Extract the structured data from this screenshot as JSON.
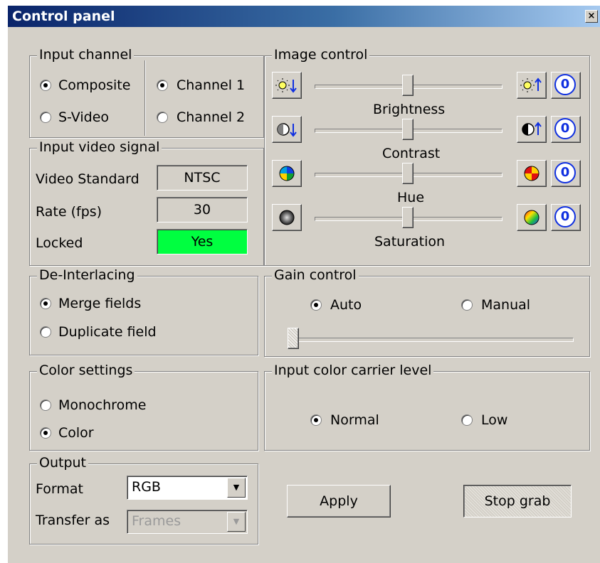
{
  "window": {
    "title": "Control panel",
    "close_glyph": "×"
  },
  "input_channel": {
    "legend": "Input channel",
    "composite": "Composite",
    "svideo": "S-Video",
    "channel1": "Channel 1",
    "channel2": "Channel 2",
    "selected_source": "Composite",
    "selected_channel": "Channel 1"
  },
  "input_video_signal": {
    "legend": "Input video signal",
    "standard_label": "Video Standard",
    "standard_value": "NTSC",
    "rate_label": "Rate (fps)",
    "rate_value": "30",
    "locked_label": "Locked",
    "locked_value": "Yes",
    "locked_color": "#00ff40"
  },
  "image_control": {
    "legend": "Image control",
    "sliders": [
      {
        "label": "Brightness",
        "level": 0.5,
        "dec_icon": "brightness-down-icon",
        "inc_icon": "brightness-up-icon"
      },
      {
        "label": "Contrast",
        "level": 0.5,
        "dec_icon": "contrast-down-icon",
        "inc_icon": "contrast-up-icon"
      },
      {
        "label": "Hue",
        "level": 0.5,
        "dec_icon": "hue-down-icon",
        "inc_icon": "hue-up-icon"
      },
      {
        "label": "Saturation",
        "level": 0.5,
        "dec_icon": "saturation-down-icon",
        "inc_icon": "saturation-up-icon"
      }
    ],
    "reset_label": "0"
  },
  "deinterlacing": {
    "legend": "De-Interlacing",
    "merge": "Merge fields",
    "duplicate": "Duplicate field",
    "selected": "Merge fields"
  },
  "gain_control": {
    "legend": "Gain control",
    "auto": "Auto",
    "manual": "Manual",
    "selected": "Auto",
    "level": 0.0
  },
  "color_settings": {
    "legend": "Color settings",
    "mono": "Monochrome",
    "color": "Color",
    "selected": "Color"
  },
  "carrier_level": {
    "legend": "Input color carrier level",
    "normal": "Normal",
    "low": "Low",
    "selected": "Normal"
  },
  "output": {
    "legend": "Output",
    "format_label": "Format",
    "format_value": "RGB",
    "transfer_label": "Transfer as",
    "transfer_value": "Frames"
  },
  "buttons": {
    "apply": "Apply",
    "stop_grab": "Stop grab"
  }
}
